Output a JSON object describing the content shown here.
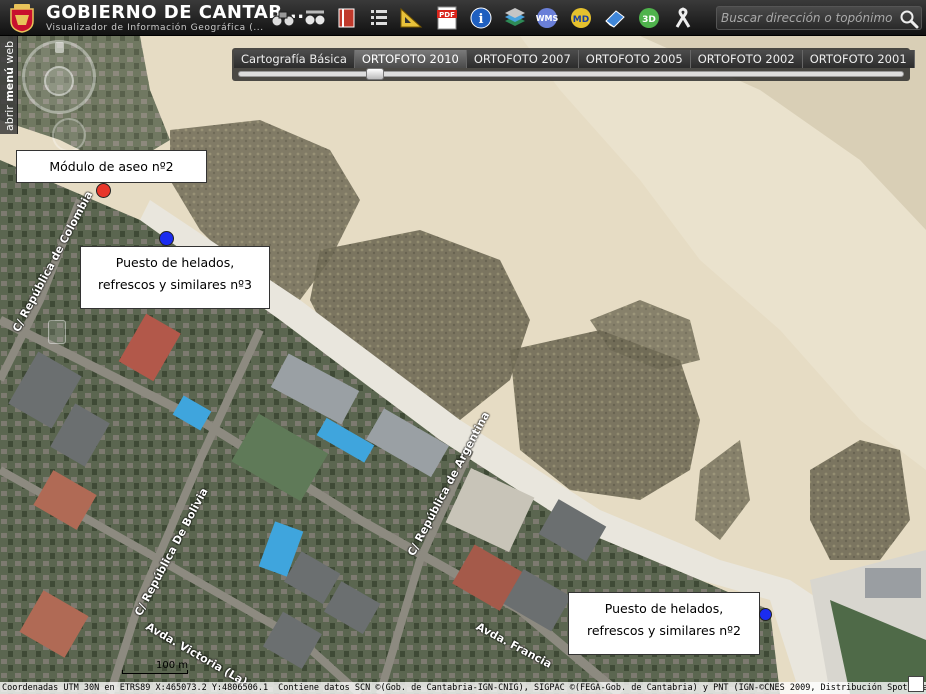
{
  "header": {
    "title": "GOBIERNO DE CANTAB...",
    "subtitle": "Visualizador de Información Geográfica (..."
  },
  "toolbar": {
    "tools": [
      {
        "icon": "binoculars-icon"
      },
      {
        "icon": "binoculars-alt-icon"
      },
      {
        "icon": "book-icon"
      },
      {
        "icon": "list-icon"
      },
      {
        "icon": "ruler-triangle-icon"
      },
      {
        "icon": "pdf-icon",
        "label": "PDF"
      },
      {
        "icon": "info-icon",
        "label": "i"
      },
      {
        "icon": "layers-icon"
      },
      {
        "icon": "wms-icon",
        "label": "WMS"
      },
      {
        "icon": "md-icon",
        "label": "MD"
      },
      {
        "icon": "eraser-icon"
      },
      {
        "icon": "3d-icon",
        "label": "3D"
      },
      {
        "icon": "ribbon-icon"
      }
    ]
  },
  "search": {
    "placeholder": "Buscar dirección o topónimo"
  },
  "side_menu": {
    "label_a": "abrir ",
    "label_b": "menú",
    "label_c": " web"
  },
  "layers": {
    "tabs": [
      "Cartografía Básica",
      "ORTOFOTO 2010",
      "ORTOFOTO 2007",
      "ORTOFOTO 2005",
      "ORTOFOTO 2002",
      "ORTOFOTO 2001"
    ],
    "active_index": 1,
    "opacity_fraction": 0.2
  },
  "markers": {
    "label1": "Módulo de aseo nº2",
    "label2_line1": "Puesto de helados,",
    "label2_line2": "refrescos y similares nº3",
    "label3_line1": "Puesto de helados,",
    "label3_line2": "refrescos y similares nº2",
    "colors": {
      "toilet": "#e8362a",
      "kiosk": "#1b2cf0"
    }
  },
  "streets": {
    "colombia": "C/ República de Colombia",
    "bolivia": "C/ República De Bolivia",
    "argentina": "C/ República de Argentina",
    "victoria": "Avda. Victoria (La)",
    "francia": "Avda. Francia"
  },
  "scale": {
    "label": "100 m"
  },
  "footer": {
    "coords": "Coordenadas UTM 30N en ETRS89 X:465073.2 Y:4806506.1",
    "credits": "Contiene datos SCN ©(Gob. de Cantabria-IGN-CNIG), SIGPAC ©(FEGA-Gob. de Cantabria) y PNT (IGN-©CNES 2009, Distribución Spot Image S.A.)"
  }
}
